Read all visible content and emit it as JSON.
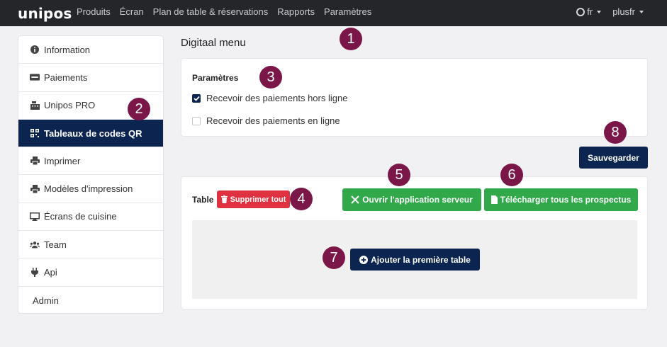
{
  "navbar": {
    "brand": "unipos",
    "links": [
      "Produits",
      "Écran",
      "Plan de table & réservations",
      "Rapports",
      "Paramètres"
    ],
    "language": "fr",
    "user": "plusfr"
  },
  "sidebar": {
    "items": [
      {
        "label": "Information",
        "icon": "info-icon",
        "active": false
      },
      {
        "label": "Paiements",
        "icon": "visa-card-icon",
        "active": false
      },
      {
        "label": "Unipos PRO",
        "icon": "cash-register-icon",
        "active": false
      },
      {
        "label": "Tableaux de codes QR",
        "icon": "qr-code-icon",
        "active": true
      },
      {
        "label": "Imprimer",
        "icon": "printer-icon",
        "active": false
      },
      {
        "label": "Modèles d'impression",
        "icon": "printer-icon",
        "active": false
      },
      {
        "label": "Écrans de cuisine",
        "icon": "monitor-icon",
        "active": false
      },
      {
        "label": "Team",
        "icon": "users-icon",
        "active": false
      },
      {
        "label": "Api",
        "icon": "plug-icon",
        "active": false
      },
      {
        "label": "Admin",
        "icon": "",
        "active": false
      }
    ]
  },
  "main": {
    "title": "Digitaal menu",
    "settings": {
      "heading": "Paramètres",
      "offline_label": "Recevoir des paiements hors ligne",
      "offline_checked": true,
      "online_label": "Recevoir des paiements en ligne",
      "online_checked": false
    },
    "save_label": "Sauvegarder",
    "table": {
      "label": "Table",
      "delete_all_label": "Supprimer tout",
      "open_server_label": "Ouvrir l'application serveur",
      "download_label": "Télécharger tous les prospectus",
      "add_first_label": "Ajouter la première table"
    }
  },
  "markers": [
    "1",
    "2",
    "3",
    "4",
    "5",
    "6",
    "7",
    "8"
  ],
  "colors": {
    "navbar": "#242629",
    "accent_navy": "#0c2450",
    "danger": "#e03140",
    "success": "#31a84a",
    "marker": "#7b1649"
  }
}
